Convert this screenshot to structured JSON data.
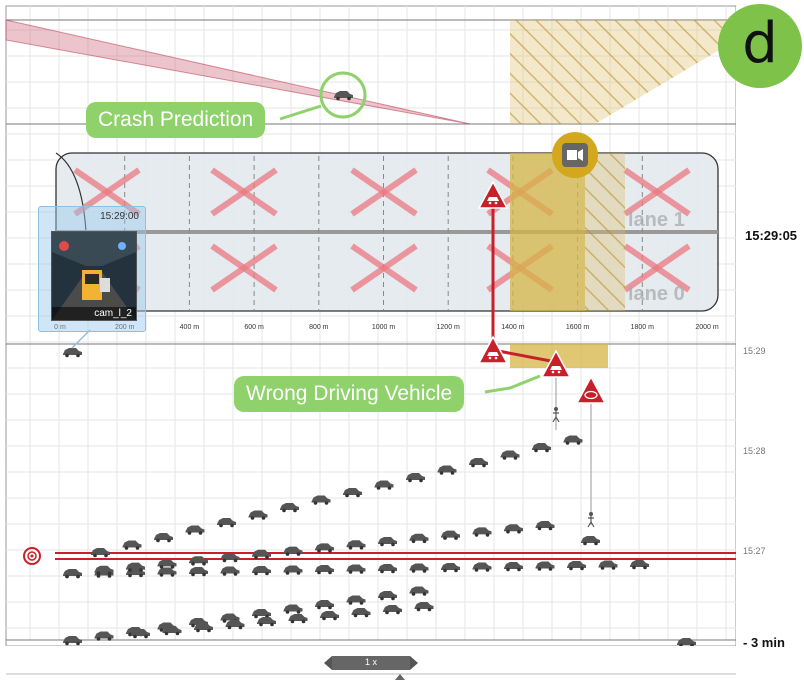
{
  "badge": {
    "letter": "d"
  },
  "callouts": {
    "crash_prediction": "Crash Prediction",
    "wrong_driving": "Wrong Driving Vehicle"
  },
  "camera_thumbnail": {
    "time": "15:29:00",
    "camera_name": "cam_l_2"
  },
  "road": {
    "lane_labels": [
      "lane 1",
      "lane 0"
    ],
    "distance_ticks": [
      "0 m",
      "200 m",
      "400 m",
      "600 m",
      "800 m",
      "1000 m",
      "1200 m",
      "1400 m",
      "1600 m",
      "1800 m",
      "2000 m"
    ]
  },
  "timeline": {
    "current_time": "15:29:05",
    "ticks": [
      "15:29",
      "15:28",
      "15:27"
    ],
    "range_label": "- 3 min"
  },
  "playback": {
    "speed": "1 x"
  },
  "colors": {
    "alert_red": "#c8202a",
    "callout_green": "#8fd16b",
    "badge_green": "#7ec24a",
    "zone_gold": "#d9b54a",
    "camera_marker": "#d4a81c"
  },
  "icons": [
    "camera-icon",
    "car-icon",
    "warning-triangle-icon",
    "pedestrian-icon",
    "incident-target-icon"
  ]
}
